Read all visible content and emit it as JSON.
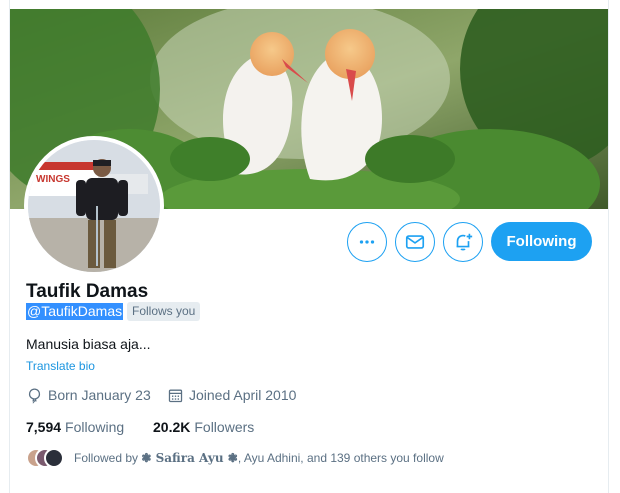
{
  "profile": {
    "name": "Taufik Damas",
    "handle": "@TaufikDamas",
    "follows_you": "Follows you",
    "bio": "Manusia biasa aja...",
    "translate_bio": "Translate bio",
    "born": "Born January 23",
    "joined": "Joined April 2010"
  },
  "stats": {
    "following_count": "7,594",
    "following_label": "Following",
    "followers_count": "20.2K",
    "followers_label": "Followers"
  },
  "followed_by": {
    "prefix": "Followed by",
    "name_1": "❃ Safira Ayu ❃",
    "rest": ", Ayu Adhini, and 139 others you follow"
  },
  "actions": {
    "following_label": "Following",
    "more_icon": "more-icon",
    "message_icon": "envelope-icon",
    "notify_icon": "bell-plus-icon"
  },
  "colors": {
    "accent": "#1da1f2",
    "link": "#1b95e0",
    "muted": "#5b7083",
    "selection": "#3390ff"
  }
}
